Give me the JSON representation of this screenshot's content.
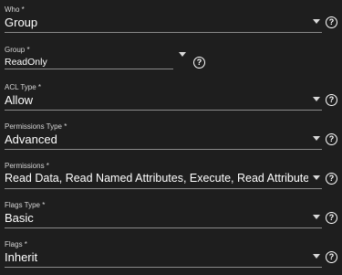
{
  "fields": [
    {
      "id": "who",
      "label": "Who *",
      "value": "Group",
      "help_icon": "question-circle-icon",
      "caret_icon": "caret-down-icon"
    },
    {
      "id": "group",
      "label": "Group *",
      "value": "ReadOnly",
      "help_icon": "question-circle-icon",
      "caret_icon": "caret-down-icon"
    },
    {
      "id": "acl-type",
      "label": "ACL Type *",
      "value": "Allow",
      "help_icon": "question-circle-icon",
      "caret_icon": "caret-down-icon"
    },
    {
      "id": "permissions-type",
      "label": "Permissions Type *",
      "value": "Advanced",
      "help_icon": "question-circle-icon",
      "caret_icon": "caret-down-icon"
    },
    {
      "id": "permissions",
      "label": "Permissions *",
      "value": "Read Data, Read Named Attributes, Execute, Read Attributes, ...",
      "help_icon": "question-circle-icon",
      "caret_icon": "caret-down-icon"
    },
    {
      "id": "flags-type",
      "label": "Flags Type *",
      "value": "Basic",
      "help_icon": "question-circle-icon",
      "caret_icon": "caret-down-icon"
    },
    {
      "id": "flags",
      "label": "Flags *",
      "value": "Inherit",
      "help_icon": "question-circle-icon",
      "caret_icon": "caret-down-icon"
    }
  ],
  "help_glyph": "?",
  "colors": {
    "background": "#1e1e1e",
    "text": "#ffffff",
    "label": "#d6d6d6",
    "underline": "#8a8a8a"
  }
}
